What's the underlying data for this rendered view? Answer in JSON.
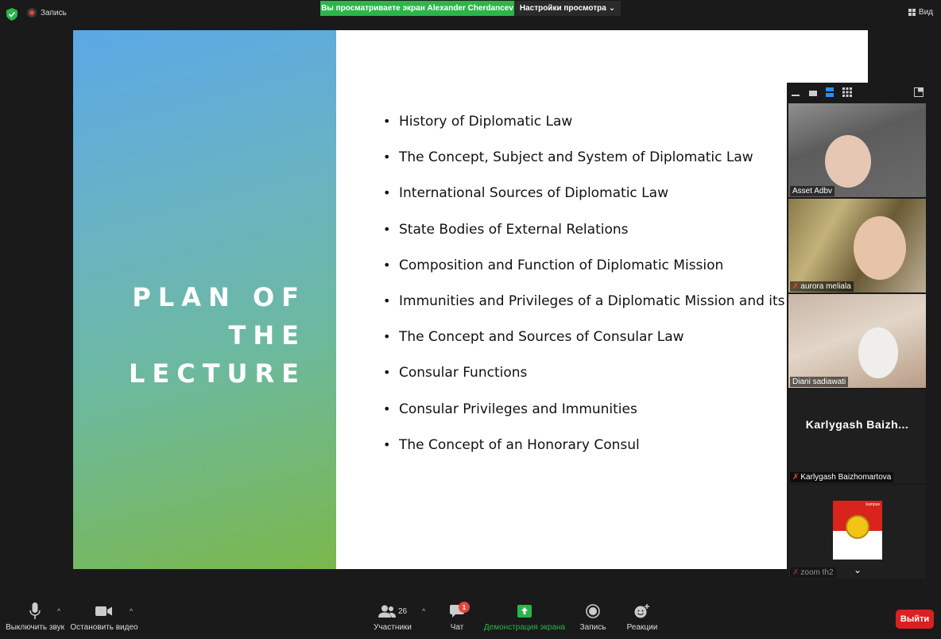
{
  "topbar": {
    "record_label": "Запись",
    "share_banner": "Вы просматриваете экран Alexander Cherdancev",
    "view_settings": "Настройки просмотра",
    "view_label": "Вид"
  },
  "slide": {
    "title_line1": "PLAN OF",
    "title_line2": "THE LECTURE",
    "items": [
      "History of Diplomatic Law",
      "The Concept, Subject and System of Diplomatic Law",
      "International Sources of Diplomatic Law",
      "State Bodies of External Relations",
      "Composition and Function of Diplomatic Mission",
      "Immunities and Privileges of a Diplomatic Mission and its Staff",
      "The Concept and Sources of Consular Law",
      "Consular Functions",
      "Consular Privileges and Immunities",
      "The Concept of an Honorary Consul"
    ],
    "colors": {
      "gradient_top": "#5ba8e6",
      "gradient_bottom": "#7ab84c"
    }
  },
  "participants": [
    {
      "name": "Asset Adbv",
      "muted": false
    },
    {
      "name": "aurora meliala",
      "muted": true
    },
    {
      "name": "Diani sadiawati",
      "muted": false
    },
    {
      "name": "Karlygash Baizhomartova",
      "display": "Karlygash  Baizh...",
      "muted": true
    },
    {
      "name": "zoom th2",
      "muted": true,
      "logo_text": "kampus"
    }
  ],
  "bottombar": {
    "mute_label": "Выключить звук",
    "video_label": "Остановить видео",
    "participants_label": "Участники",
    "participants_count": "26",
    "chat_label": "Чат",
    "chat_badge": "1",
    "share_label": "Демонстрация экрана",
    "record_label": "Запись",
    "reactions_label": "Реакции",
    "leave_label": "Выйти"
  },
  "icons": {
    "security": "shield-icon",
    "mic": "microphone-icon",
    "video": "video-camera-icon",
    "participants": "people-icon",
    "chat": "chat-bubble-icon",
    "share": "share-screen-icon",
    "record": "record-icon",
    "reactions": "emoji-plus-icon"
  },
  "accent_colors": {
    "green": "#2bb54a",
    "red": "#d92121"
  }
}
